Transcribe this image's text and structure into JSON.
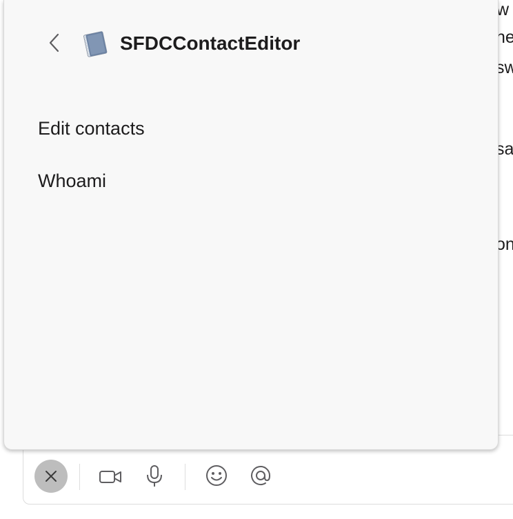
{
  "background_text": [
    "w",
    "ne",
    "sw",
    "sa",
    "on"
  ],
  "panel": {
    "title": "SFDCContactEditor",
    "back_icon": "chevron-left-icon",
    "app_icon": "notebook-icon",
    "items": [
      {
        "label": "Edit contacts"
      },
      {
        "label": "Whoami"
      }
    ]
  },
  "composer": {
    "tools": [
      "close-icon",
      "video-icon",
      "microphone-icon",
      "emoji-icon",
      "mention-icon"
    ]
  },
  "colors": {
    "panel_bg": "#f8f8f8",
    "text": "#1d1c1d",
    "close_btn_bg": "#bdbdbd",
    "icon": "#5e5d60"
  }
}
